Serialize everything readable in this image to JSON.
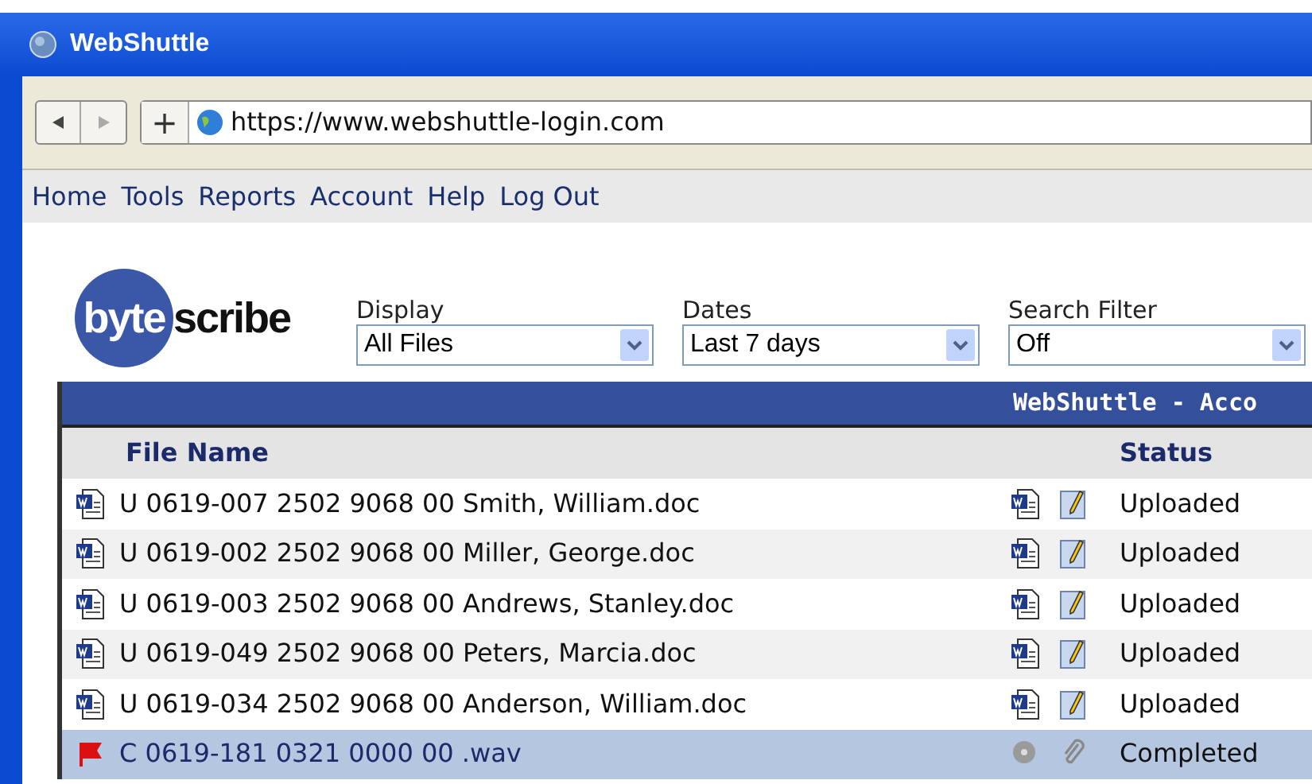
{
  "window": {
    "title": "WebShuttle"
  },
  "browser": {
    "url": "https://www.webshuttle-login.com",
    "new_tab": "+"
  },
  "menu": [
    "Home",
    "Tools",
    "Reports",
    "Account",
    "Help",
    "Log Out"
  ],
  "logo": {
    "mark": "byte",
    "word": "scribe"
  },
  "filters": [
    {
      "label": "Display",
      "value": "All Files"
    },
    {
      "label": "Dates",
      "value": "Last 7 days"
    },
    {
      "label": "Search Filter",
      "value": "Off"
    }
  ],
  "table": {
    "title": "WebShuttle - Acco",
    "columns": [
      "File Name",
      "Status"
    ],
    "rows": [
      {
        "kind": "doc",
        "name": "U 0619-007 2502 9068 00 Smith, William.doc",
        "status": "Uploaded",
        "selected": false
      },
      {
        "kind": "doc",
        "name": "U 0619-002 2502 9068 00 Miller, George.doc",
        "status": "Uploaded",
        "selected": false
      },
      {
        "kind": "doc",
        "name": "U 0619-003 2502 9068 00 Andrews, Stanley.doc",
        "status": "Uploaded",
        "selected": false
      },
      {
        "kind": "doc",
        "name": "U 0619-049 2502 9068 00 Peters, Marcia.doc",
        "status": "Uploaded",
        "selected": false
      },
      {
        "kind": "doc",
        "name": "U 0619-034 2502 9068 00 Anderson, William.doc",
        "status": "Uploaded",
        "selected": false
      },
      {
        "kind": "audio",
        "name": "C 0619-181 0321 0000 00 .wav",
        "status": "Completed",
        "selected": true
      }
    ]
  }
}
